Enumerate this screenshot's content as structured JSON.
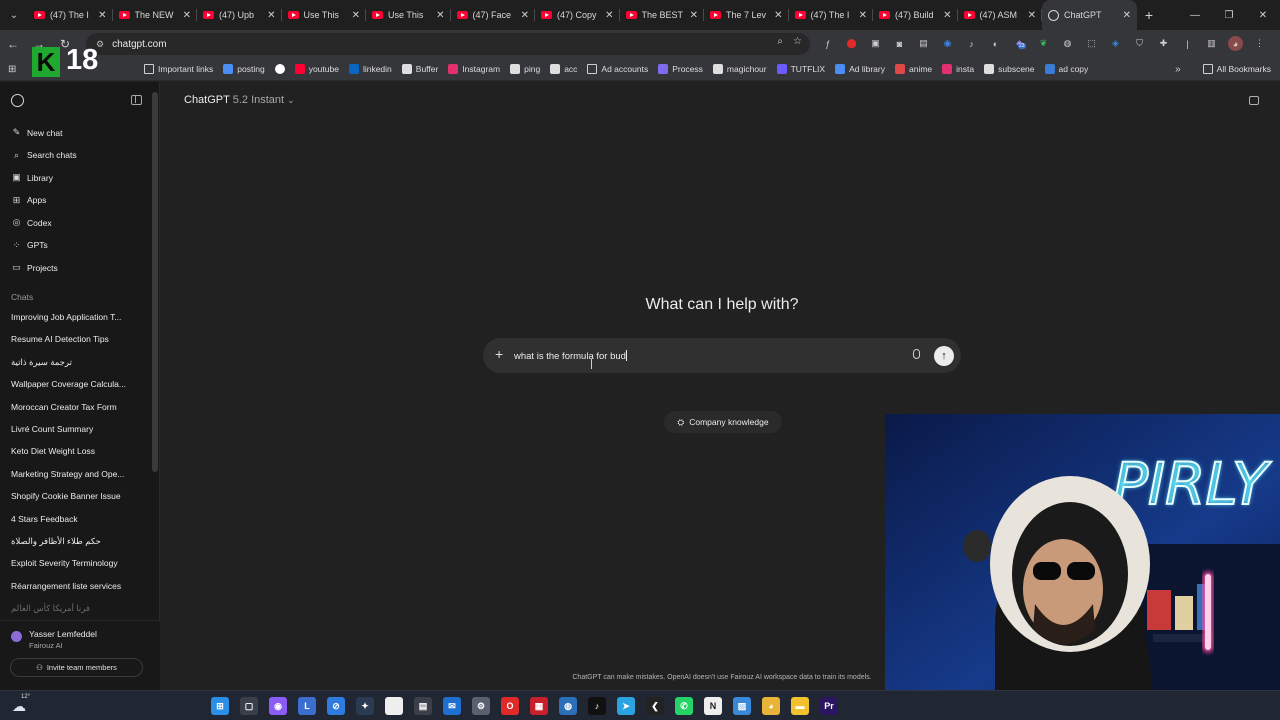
{
  "browser": {
    "tabs": [
      {
        "title": "(47) The I",
        "favicon": "youtube-icon"
      },
      {
        "title": "The NEW",
        "favicon": "youtube-icon"
      },
      {
        "title": "(47) Upb",
        "favicon": "youtube-icon"
      },
      {
        "title": "Use This",
        "favicon": "youtube-icon"
      },
      {
        "title": "Use This",
        "favicon": "youtube-icon"
      },
      {
        "title": "(47) Face",
        "favicon": "youtube-icon"
      },
      {
        "title": "(47) Copy",
        "favicon": "youtube-icon"
      },
      {
        "title": "The BEST",
        "favicon": "youtube-icon"
      },
      {
        "title": "The 7 Lev",
        "favicon": "youtube-icon"
      },
      {
        "title": "(47) The I",
        "favicon": "youtube-icon"
      },
      {
        "title": "(47) Build",
        "favicon": "youtube-icon"
      },
      {
        "title": "(47) ASM",
        "favicon": "youtube-icon"
      }
    ],
    "active_tab": {
      "title": "ChatGPT",
      "favicon": "chatgpt-icon"
    },
    "url": "chatgpt.com",
    "bookmarks": [
      {
        "label": "Important links",
        "icon": "folder-icon",
        "color": "#cfcfcf"
      },
      {
        "label": "posting",
        "icon": "meta-icon",
        "color": "#4a8df5"
      },
      {
        "label": "",
        "icon": "google-icon",
        "color": "#ffffff"
      },
      {
        "label": "youtube",
        "icon": "youtube-icon",
        "color": "#ff0033"
      },
      {
        "label": "linkedin",
        "icon": "linkedin-icon",
        "color": "#0a66c2"
      },
      {
        "label": "Buffer",
        "icon": "buffer-icon",
        "color": "#dedede"
      },
      {
        "label": "Instagram",
        "icon": "instagram-icon",
        "color": "#e1306c"
      },
      {
        "label": "ping",
        "icon": "ping-icon",
        "color": "#dedede"
      },
      {
        "label": "acc",
        "icon": "acc-icon",
        "color": "#dedede"
      },
      {
        "label": "Ad accounts",
        "icon": "folder-icon",
        "color": "#cfcfcf"
      },
      {
        "label": "Process",
        "icon": "process-icon",
        "color": "#7b6cf0"
      },
      {
        "label": "magichour",
        "icon": "magichour-icon",
        "color": "#dedede"
      },
      {
        "label": "TUTFLIX",
        "icon": "tutflix-icon",
        "color": "#6b5cff"
      },
      {
        "label": "Ad library",
        "icon": "meta-icon",
        "color": "#4a8df5"
      },
      {
        "label": "anime",
        "icon": "anime-icon",
        "color": "#e04848"
      },
      {
        "label": "insta",
        "icon": "instagram-icon",
        "color": "#e1306c"
      },
      {
        "label": "subscene",
        "icon": "subscene-icon",
        "color": "#dedede"
      },
      {
        "label": "ad copy",
        "icon": "ad-copy-icon",
        "color": "#3a7bd5"
      }
    ],
    "all_bookmarks": "All Bookmarks",
    "profile_badge": "23"
  },
  "overlay": {
    "logo_letter": "K",
    "logo_number": "18"
  },
  "sidebar": {
    "nav": [
      {
        "label": "New chat",
        "icon": "edit-icon",
        "glyph": "✎"
      },
      {
        "label": "Search chats",
        "icon": "search-icon",
        "glyph": "⌕"
      },
      {
        "label": "Library",
        "icon": "library-icon",
        "glyph": "▣"
      },
      {
        "label": "Apps",
        "icon": "apps-icon",
        "glyph": "⊞"
      },
      {
        "label": "Codex",
        "icon": "codex-icon",
        "glyph": "◎"
      },
      {
        "label": "GPTs",
        "icon": "gpts-icon",
        "glyph": "⁘"
      },
      {
        "label": "Projects",
        "icon": "projects-icon",
        "glyph": "▭"
      }
    ],
    "section_label": "Chats",
    "chats": [
      {
        "label": "Improving Job Application T...",
        "rtl": false
      },
      {
        "label": "Resume AI Detection Tips",
        "rtl": false
      },
      {
        "label": "ترجمة سيرة ذاتية",
        "rtl": true
      },
      {
        "label": "Wallpaper Coverage Calcula...",
        "rtl": false
      },
      {
        "label": "Moroccan Creator Tax Form",
        "rtl": false
      },
      {
        "label": "Livré Count Summary",
        "rtl": false
      },
      {
        "label": "Keto Diet Weight Loss",
        "rtl": false
      },
      {
        "label": "Marketing Strategy and Ope...",
        "rtl": false
      },
      {
        "label": "Shopify Cookie Banner Issue",
        "rtl": false
      },
      {
        "label": "4 Stars Feedback",
        "rtl": false
      },
      {
        "label": "حكم طلاء الأظافر والصلاة",
        "rtl": true
      },
      {
        "label": "Exploit Severity Terminology",
        "rtl": false
      },
      {
        "label": "Réarrangement liste services",
        "rtl": false
      },
      {
        "label": "فرنا أمريكا كأس العالم",
        "rtl": true
      }
    ],
    "user": {
      "name": "Yasser Lemfeddel",
      "org": "Fairouz AI"
    },
    "invite_label": "Invite team members"
  },
  "main": {
    "model_name": "ChatGPT",
    "model_version": "5.2 Instant",
    "heading": "What can I help with?",
    "composer_text": "what is the formula for bud",
    "knowledge_label": "Company knowledge",
    "disclaimer": "ChatGPT can make mistakes. OpenAI doesn't use Fairouz AI workspace data to train its models."
  },
  "webcam": {
    "sign_text": "PIRLY"
  },
  "taskbar": {
    "temperature": "12°",
    "icons": [
      {
        "name": "windows-start-icon",
        "color": "#2b8fe8",
        "glyph": "⊞"
      },
      {
        "name": "task-view-icon",
        "color": "#3a3f4a",
        "glyph": "▢"
      },
      {
        "name": "copilot-icon",
        "color": "#8b5cf6",
        "glyph": "◉"
      },
      {
        "name": "app-l-icon",
        "color": "#3a6fd0",
        "glyph": "L"
      },
      {
        "name": "app-blue-icon",
        "color": "#2f7be0",
        "glyph": "⊘"
      },
      {
        "name": "app-feather-icon",
        "color": "#2a3a50",
        "glyph": "✦"
      },
      {
        "name": "app-white-icon",
        "color": "#eeeeee",
        "glyph": ""
      },
      {
        "name": "store-icon",
        "color": "#3a3f4a",
        "glyph": "▤"
      },
      {
        "name": "outlook-icon",
        "color": "#1f6fd0",
        "glyph": "✉"
      },
      {
        "name": "settings-icon",
        "color": "#5a6070",
        "glyph": "⚙"
      },
      {
        "name": "opera-icon",
        "color": "#e02a2a",
        "glyph": "O"
      },
      {
        "name": "app-red-icon",
        "color": "#c8202a",
        "glyph": "▦"
      },
      {
        "name": "app-globe-icon",
        "color": "#2a6fb8",
        "glyph": "◍"
      },
      {
        "name": "tiktok-icon",
        "color": "#111111",
        "glyph": "♪"
      },
      {
        "name": "telegram-icon",
        "color": "#2aa3e0",
        "glyph": "➤"
      },
      {
        "name": "app-arrow-icon",
        "color": "#222222",
        "glyph": "❮"
      },
      {
        "name": "whatsapp-icon",
        "color": "#25d366",
        "glyph": "✆"
      },
      {
        "name": "notion-icon",
        "color": "#eeeeee",
        "glyph": "N"
      },
      {
        "name": "photos-icon",
        "color": "#3a88d8",
        "glyph": "▨"
      },
      {
        "name": "chrome-icon",
        "color": "#e8b339",
        "glyph": "◕"
      },
      {
        "name": "file-explorer-icon",
        "color": "#f2c230",
        "glyph": "▬"
      },
      {
        "name": "premiere-icon",
        "color": "#2a1660",
        "glyph": "Pr"
      }
    ]
  }
}
